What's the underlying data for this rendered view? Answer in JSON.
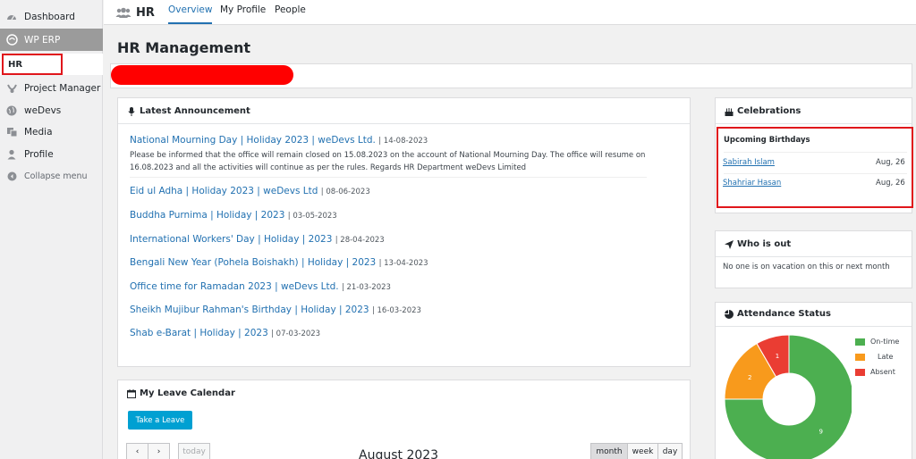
{
  "sidebar": {
    "items": [
      {
        "label": "Dashboard",
        "icon": "dashboard-icon"
      },
      {
        "label": "WP ERP",
        "icon": "erp-icon"
      },
      {
        "label": "HR"
      },
      {
        "label": "Project Manager",
        "icon": "project-manager-icon"
      },
      {
        "label": "weDevs",
        "icon": "globe-icon"
      },
      {
        "label": "Media",
        "icon": "media-icon"
      },
      {
        "label": "Profile",
        "icon": "user-icon"
      },
      {
        "label": "Collapse menu",
        "icon": "collapse-icon"
      }
    ]
  },
  "topnav": {
    "title": "HR",
    "tabs": [
      "Overview",
      "My Profile",
      "People"
    ],
    "active_color": "#2271b1"
  },
  "page": {
    "title": "HR Management"
  },
  "announcements": {
    "title": "Latest Announcement",
    "featured_description": "Please be informed that the office will remain closed on 15.08.2023 on the account of National Mourning Day. The office will resume on 16.08.2023 and all the activities will continue as per the rules. Regards HR Department weDevs Limited",
    "items": [
      {
        "title": "National Mourning Day | Holiday 2023 | weDevs Ltd.",
        "date": "| 14-08-2023"
      },
      {
        "title": "Eid ul Adha | Holiday 2023 | weDevs Ltd",
        "date": "| 08-06-2023"
      },
      {
        "title": "Buddha Purnima | Holiday | 2023",
        "date": "| 03-05-2023"
      },
      {
        "title": "International Workers' Day | Holiday | 2023",
        "date": "| 28-04-2023"
      },
      {
        "title": "Bengali New Year (Pohela Boishakh) | Holiday | 2023",
        "date": "| 13-04-2023"
      },
      {
        "title": "Office time for Ramadan 2023 | weDevs Ltd.",
        "date": "| 21-03-2023"
      },
      {
        "title": "Sheikh Mujibur Rahman's Birthday | Holiday | 2023",
        "date": "| 16-03-2023"
      },
      {
        "title": "Shab e-Barat | Holiday | 2023",
        "date": "| 07-03-2023"
      }
    ]
  },
  "celebrations": {
    "title": "Celebrations",
    "subtitle": "Upcoming Birthdays",
    "birthdays": [
      {
        "name": "Sabirah Islam",
        "date": "Aug, 26"
      },
      {
        "name": "Shahriar Hasan",
        "date": "Aug, 26"
      }
    ]
  },
  "who_is_out": {
    "title": "Who is out",
    "message": "No one is on vacation on this or next month"
  },
  "attendance": {
    "title": "Attendance Status",
    "legend": [
      "On-time",
      "Late",
      "Absent"
    ]
  },
  "leave_calendar": {
    "title": "My Leave Calendar",
    "take_leave": "Take a Leave",
    "prev": "‹",
    "next": "›",
    "today": "today",
    "month_title": "August 2023",
    "views": [
      "month",
      "week",
      "day"
    ]
  },
  "chart_data": {
    "type": "pie",
    "categories": [
      "On-time",
      "Late",
      "Absent"
    ],
    "values": [
      9,
      2,
      1
    ],
    "colors": [
      "#4caf50",
      "#f89a1c",
      "#ea3d33"
    ],
    "legend_position": "right"
  }
}
